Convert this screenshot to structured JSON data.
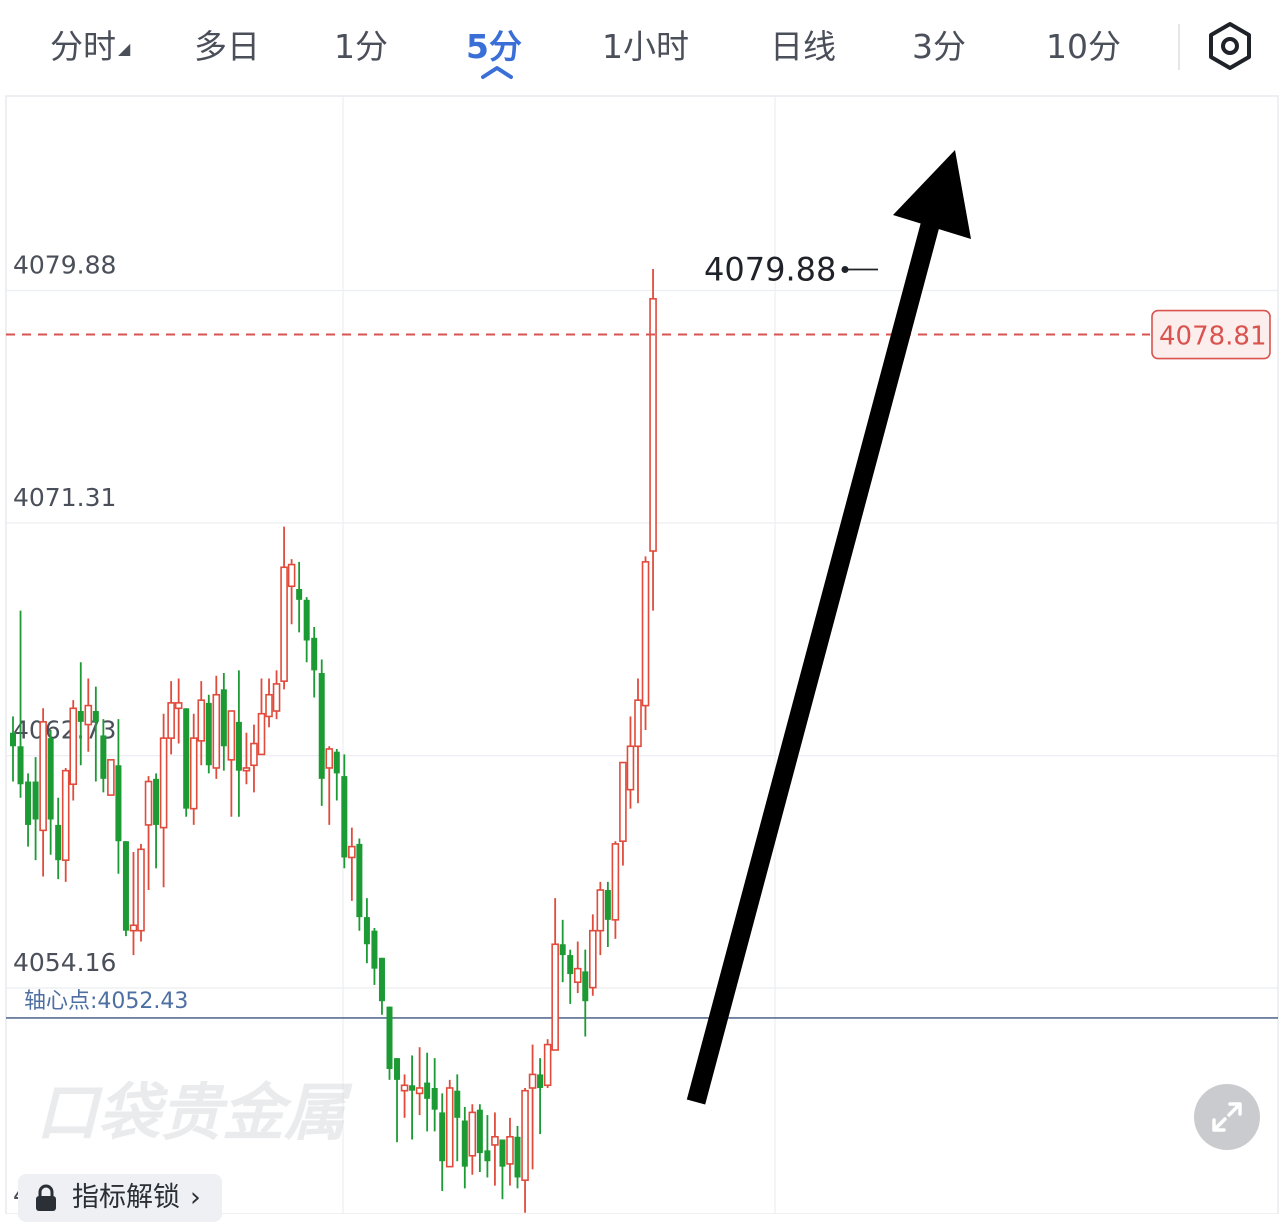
{
  "tabs": [
    {
      "label": "分时",
      "active": false,
      "has_caret": true
    },
    {
      "label": "多日",
      "active": false
    },
    {
      "label": "1分",
      "active": false
    },
    {
      "label": "5分",
      "active": true
    },
    {
      "label": "1小时",
      "active": false
    },
    {
      "label": "日线",
      "active": false
    },
    {
      "label": "3分",
      "active": false
    },
    {
      "label": "10分",
      "active": false
    }
  ],
  "icons": {
    "settings": "hexagon-settings-icon",
    "lock": "lock-icon",
    "expand": "expand-arrows-icon",
    "chevron": "chevron-right-icon"
  },
  "colors": {
    "up": "#e04b3c",
    "down": "#1c9a33",
    "pivot": "#5a6f90",
    "last": "#d9534f",
    "accent": "#3a6fd8"
  },
  "indicator_unlock": {
    "label": "指标解锁",
    "arrow": "›"
  },
  "watermark": "口袋贵金属",
  "chart_data": {
    "type": "candlestick",
    "interval": "5分",
    "y_ticks": [
      "4079.88",
      "4071.31",
      "4062.73",
      "4054.16",
      "4045.59"
    ],
    "ylim": [
      4042.1,
      4082.9
    ],
    "grid": true,
    "high_label": "4079.88",
    "low_label": "4045.59",
    "last_price": 4078.81,
    "last_price_label": "4078.81",
    "pivot_label": "轴心点:4052.43",
    "pivot_value": 4052.43,
    "annotation": "trend-up-arrow",
    "candles": [
      [
        4062.8,
        4062.3,
        4063.4,
        4061.0
      ],
      [
        4062.3,
        4060.9,
        4067.3,
        4060.4
      ],
      [
        4061.0,
        4059.4,
        4061.3,
        4058.6
      ],
      [
        4061.0,
        4059.6,
        4061.9,
        4058.1
      ],
      [
        4059.2,
        4063.2,
        4063.7,
        4057.5
      ],
      [
        4062.6,
        4059.6,
        4062.9,
        4058.3
      ],
      [
        4059.4,
        4058.1,
        4060.4,
        4057.4
      ],
      [
        4058.1,
        4061.4,
        4061.5,
        4057.3
      ],
      [
        4060.9,
        4063.7,
        4064.0,
        4060.3
      ],
      [
        4063.6,
        4063.2,
        4065.4,
        4061.6
      ],
      [
        4063.1,
        4063.8,
        4064.8,
        4062.1
      ],
      [
        4063.6,
        4063.2,
        4064.5,
        4061.0
      ],
      [
        4062.7,
        4061.1,
        4063.3,
        4060.6
      ],
      [
        4060.5,
        4061.8,
        4061.8,
        4061.8
      ],
      [
        4061.6,
        4058.8,
        4063.3,
        4057.6
      ],
      [
        4058.8,
        4055.5,
        4058.8,
        4055.3
      ],
      [
        4055.5,
        4055.7,
        4058.4,
        4054.6
      ],
      [
        4055.5,
        4058.5,
        4058.7,
        4055.1
      ],
      [
        4059.4,
        4061.0,
        4061.2,
        4057.0
      ],
      [
        4061.1,
        4059.4,
        4061.3,
        4057.8
      ],
      [
        4059.3,
        4062.6,
        4063.5,
        4057.1
      ],
      [
        4062.6,
        4063.9,
        4064.7,
        4062.0
      ],
      [
        4063.7,
        4063.9,
        4064.8,
        4062.4
      ],
      [
        4063.7,
        4060.0,
        4063.7,
        4059.7
      ],
      [
        4060.0,
        4062.6,
        4063.5,
        4059.4
      ],
      [
        4062.5,
        4064.0,
        4064.7,
        4061.6
      ],
      [
        4063.9,
        4061.6,
        4064.2,
        4061.3
      ],
      [
        4061.5,
        4064.2,
        4064.9,
        4061.1
      ],
      [
        4064.4,
        4062.3,
        4065.0,
        4061.4
      ],
      [
        4061.8,
        4063.6,
        4063.6,
        4059.7
      ],
      [
        4063.2,
        4061.4,
        4065.1,
        4059.7
      ],
      [
        4061.4,
        4061.5,
        4062.8,
        4060.9
      ],
      [
        4061.6,
        4062.4,
        4063.1,
        4060.6
      ],
      [
        4062.0,
        4063.5,
        4064.8,
        4062.0
      ],
      [
        4063.4,
        4064.2,
        4064.8,
        4063.0
      ],
      [
        4063.6,
        4064.6,
        4065.1,
        4063.3
      ],
      [
        4064.7,
        4068.9,
        4070.4,
        4064.4
      ],
      [
        4068.2,
        4069.0,
        4069.2,
        4066.8
      ],
      [
        4068.1,
        4067.7,
        4069.1,
        4066.5
      ],
      [
        4067.7,
        4066.2,
        4067.8,
        4065.4
      ],
      [
        4066.3,
        4065.1,
        4066.7,
        4064.1
      ],
      [
        4065.0,
        4061.1,
        4065.5,
        4060.1
      ],
      [
        4061.5,
        4062.2,
        4062.3,
        4059.4
      ],
      [
        4062.1,
        4061.3,
        4062.2,
        4060.3
      ],
      [
        4061.2,
        4058.2,
        4062.0,
        4057.8
      ],
      [
        4058.2,
        4058.6,
        4059.3,
        4056.6
      ],
      [
        4058.7,
        4056.0,
        4058.9,
        4055.5
      ],
      [
        4056.0,
        4055.0,
        4056.7,
        4054.3
      ],
      [
        4055.5,
        4054.1,
        4055.6,
        4053.5
      ],
      [
        4054.5,
        4052.9,
        4054.5,
        4052.4
      ],
      [
        4052.7,
        4050.4,
        4052.7,
        4050.0
      ],
      [
        4050.8,
        4050.0,
        4050.8,
        4047.7
      ],
      [
        4049.6,
        4049.8,
        4050.2,
        4048.6
      ],
      [
        4049.8,
        4049.6,
        4050.9,
        4047.8
      ],
      [
        4049.5,
        4049.7,
        4051.2,
        4048.7
      ],
      [
        4049.9,
        4049.3,
        4051.0,
        4048.1
      ],
      [
        4049.7,
        4048.9,
        4050.8,
        4048.1
      ],
      [
        4048.8,
        4047.0,
        4049.5,
        4045.9
      ],
      [
        4046.8,
        4049.7,
        4050.0,
        4047.5
      ],
      [
        4049.6,
        4048.6,
        4050.2,
        4047.0
      ],
      [
        4048.5,
        4046.8,
        4049.0,
        4046.0
      ],
      [
        4047.2,
        4048.8,
        4049.1,
        4046.5
      ],
      [
        4048.9,
        4047.3,
        4049.1,
        4046.6
      ],
      [
        4047.4,
        4047.0,
        4048.7,
        4046.4
      ],
      [
        4047.6,
        4047.9,
        4048.8,
        4046.1
      ],
      [
        4047.8,
        4046.8,
        4047.8,
        4045.6
      ],
      [
        4046.9,
        4047.9,
        4048.6,
        4046.1
      ],
      [
        4047.9,
        4046.4,
        4048.3,
        4046.0
      ],
      [
        4046.3,
        4049.6,
        4049.7,
        4045.1
      ],
      [
        4049.7,
        4050.2,
        4051.3,
        4046.7
      ],
      [
        4050.2,
        4049.7,
        4050.8,
        4048.0
      ],
      [
        4049.8,
        4051.3,
        4051.5,
        4049.7
      ],
      [
        4051.1,
        4055.0,
        4056.7,
        4051.1
      ],
      [
        4055.0,
        4054.6,
        4055.9,
        4053.6
      ],
      [
        4054.6,
        4053.9,
        4054.8,
        4052.8
      ],
      [
        4053.6,
        4054.1,
        4055.1,
        4053.2
      ],
      [
        4054.0,
        4052.9,
        4054.8,
        4051.6
      ],
      [
        4053.4,
        4055.5,
        4056.1,
        4053.1
      ],
      [
        4055.5,
        4057.0,
        4057.3,
        4054.6
      ],
      [
        4057.0,
        4055.9,
        4057.3,
        4054.9
      ],
      [
        4055.9,
        4058.7,
        4058.8,
        4055.2
      ],
      [
        4058.8,
        4061.7,
        4061.7,
        4057.9
      ],
      [
        4060.7,
        4062.3,
        4063.4,
        4060.0
      ],
      [
        4062.3,
        4064.0,
        4064.8,
        4060.2
      ],
      [
        4063.8,
        4069.1,
        4069.3,
        4062.9
      ],
      [
        4069.5,
        4078.8,
        4079.9,
        4067.3
      ]
    ]
  }
}
